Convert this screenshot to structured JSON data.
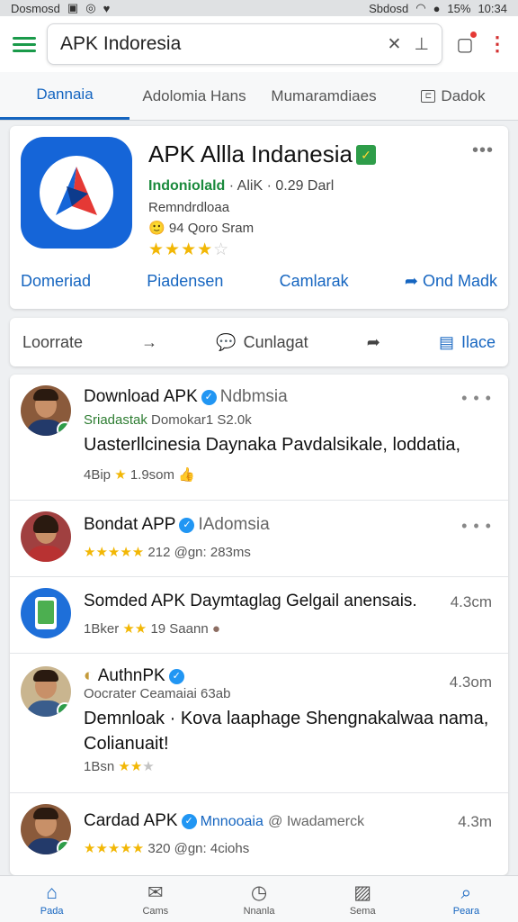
{
  "status": {
    "carrier": "Dosmosd",
    "signal": "Sbdosd",
    "battery": "15%",
    "time": "10:34"
  },
  "search": {
    "query": "APK Indoresia"
  },
  "tabs": [
    {
      "label": "Dannaia",
      "active": true
    },
    {
      "label": "Adolomia Hans"
    },
    {
      "label": "Mumaramdiaes"
    },
    {
      "label": "Dadok"
    }
  ],
  "featured": {
    "title": "APK Allla Indanesia",
    "dev_name": "Indoniolald",
    "dev_meta": "· AliK · 0.29 Darl",
    "category": "Remndrdloaa",
    "users": "94 Qoro Sram",
    "stars": "★★★★",
    "stars_off": "☆",
    "actions": [
      "Domeriad",
      "Piadensen",
      "Camlarak",
      "Ond Madk"
    ]
  },
  "toolbar": {
    "left": "Loorrate",
    "middle": "Cunlagat",
    "right": "Ilace"
  },
  "list": [
    {
      "name": "Download APK",
      "name_sub": "Ndbmsia",
      "line2_green": "Sriadastak",
      "line2": "Domokar1 S2.0k",
      "body": "Uasterllcinesia Daynaka Pavdalsikale, loddatia,",
      "meta_prefix": "4Bip",
      "meta_stars": "★",
      "meta_suffix": "1.9som"
    },
    {
      "name": "Bondat APP",
      "name_sub": "IAdomsia",
      "meta_stars": "★★★★★",
      "meta_suffix": "212 @gn: 283ms"
    },
    {
      "name": "Somded APK Daymtaglag Gelgail anensais.",
      "time": "4.3cm",
      "meta_prefix": "1Bker",
      "meta_stars": "★★",
      "meta_suffix": "19 Saann"
    },
    {
      "name": "AuthnPK",
      "time": "4.3om",
      "line2": "Oocrater Ceamaiai 63ab",
      "body": "Demnloak · Kova laaphage Shengnakalwaa nama, Colianuait!",
      "meta_prefix": "1Bsn",
      "meta_stars": "★★",
      "meta_stars_off": "★"
    },
    {
      "name": "Cardad APK",
      "name_sub": "Mnnooaia",
      "name_tail": "@ Iwadamerck",
      "time": "4.3m",
      "meta_stars": "★★★★★",
      "meta_suffix": "320 @gn: 4ciohs"
    }
  ],
  "bottom_nav": [
    {
      "label": "Pada",
      "icon": "home-icon",
      "active": true
    },
    {
      "label": "Cams",
      "icon": "mail-icon"
    },
    {
      "label": "Nnanla",
      "icon": "clock-icon"
    },
    {
      "label": "Sema",
      "icon": "image-icon"
    },
    {
      "label": "Peara",
      "icon": "search-icon"
    }
  ],
  "colors": {
    "accent": "#1565c0",
    "brand_green": "#1a9a4a",
    "star": "#f2b705",
    "logo_blue": "#1565d8"
  }
}
